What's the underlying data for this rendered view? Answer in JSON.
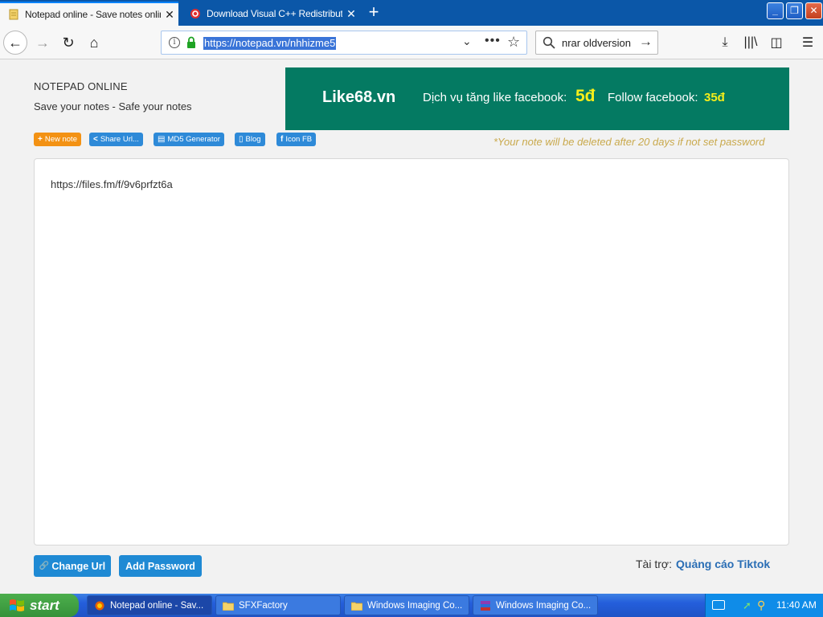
{
  "browser": {
    "tabs": [
      {
        "label": "Notepad online - Save notes online",
        "favicon": "notepad-icon",
        "active": true
      },
      {
        "label": "Download Visual C++ Redistributable",
        "favicon": "opera-o-icon",
        "active": false
      }
    ],
    "new_tab": "+",
    "window_controls": {
      "minimize": "_",
      "maximize": "❐",
      "close": "✕"
    },
    "url": "https://notepad.vn/nhhizme5",
    "search_text": "nrar oldversion",
    "icons": {
      "back": "←",
      "forward": "→",
      "reload": "↻",
      "home": "⌂",
      "info": "i",
      "dropdown": "⌄",
      "more": "•••",
      "bookmark": "☆",
      "go": "→",
      "downloads": "⤓",
      "library": "|||\\",
      "sidebar": "◫",
      "menu": "☰"
    }
  },
  "page": {
    "site_title": "NOTEPAD ONLINE",
    "tagline": "Save your notes - Safe your notes",
    "ad": {
      "brand": "Like68.vn",
      "like_label": "Dịch vụ tăng like facebook:",
      "like_price": "5đ",
      "follow_label": "Follow facebook:",
      "follow_price": "35đ",
      "bg_color": "#047a62",
      "price_color": "#f6ee1a"
    },
    "chips": [
      {
        "icon": "+",
        "label": "New note"
      },
      {
        "icon": "<",
        "label": "Share Url..."
      },
      {
        "icon": "▤",
        "label": "MD5 Generator"
      },
      {
        "icon": "▯",
        "label": "Blog"
      },
      {
        "icon": "f",
        "label": "Icon FB"
      }
    ],
    "delete_notice": "*Your note will be deleted after 20 days if not set password",
    "note_content": "https://files.fm/f/9v6prfzt6a",
    "buttons": {
      "change_url": "Change Url",
      "change_url_icon": "🔗",
      "add_password": "Add Password"
    },
    "sponsor_label": "Tài trợ:",
    "sponsor_link": "Quảng cáo Tiktok"
  },
  "taskbar": {
    "start": "start",
    "tasks": [
      {
        "label": "Notepad online - Sav...",
        "icon": "firefox-icon"
      },
      {
        "label": "SFXFactory",
        "icon": "folder-icon"
      },
      {
        "label": "Windows Imaging Co...",
        "icon": "folder-icon"
      },
      {
        "label": "Windows Imaging Co...",
        "icon": "winrar-icon"
      }
    ],
    "clock": "11:40 AM"
  }
}
